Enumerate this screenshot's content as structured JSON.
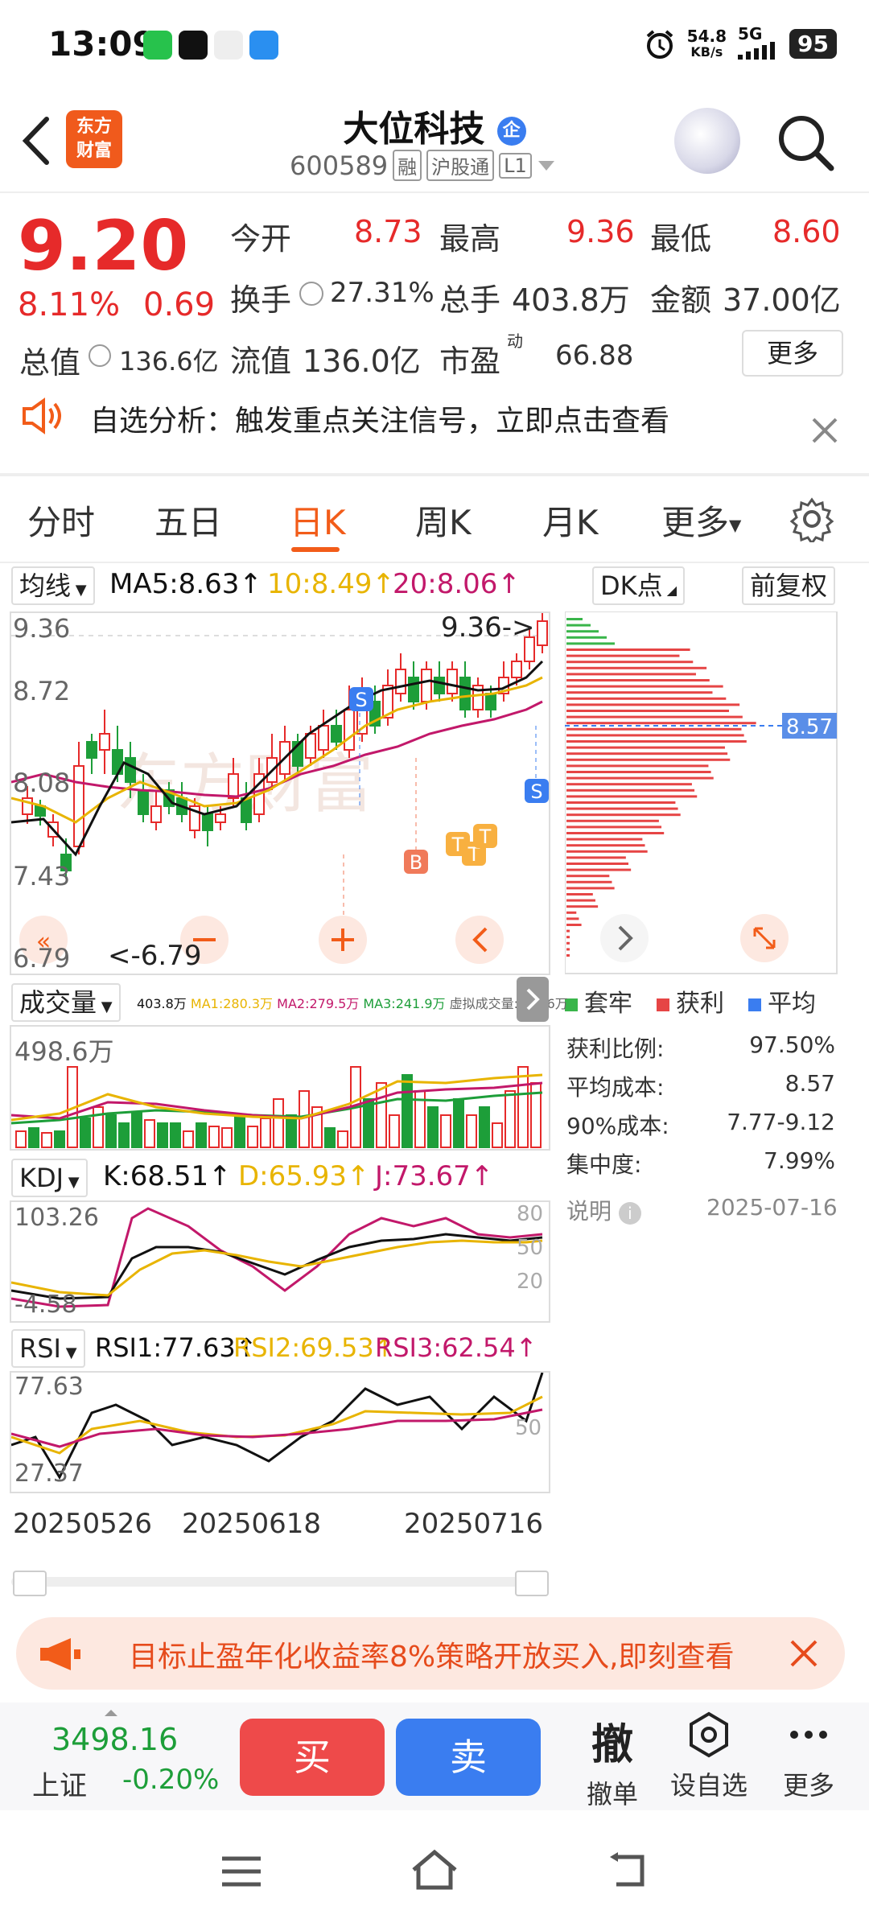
{
  "status_bar": {
    "time": "13:09",
    "net_speed": "54.8",
    "net_unit": "KB/s",
    "signal": "5G",
    "battery": "95"
  },
  "header": {
    "logo_line1": "东方",
    "logo_line2": "财富",
    "stock_name": "大位科技",
    "company_badge": "企",
    "stock_code": "600589",
    "tag_margin": "融",
    "tag_connect": "沪股通",
    "tag_level": "L1"
  },
  "quote": {
    "price": "9.20",
    "change_pct": "8.11%",
    "change_val": "0.69",
    "open_label": "今开",
    "open_val": "8.73",
    "high_label": "最高",
    "high_val": "9.36",
    "low_label": "最低",
    "low_val": "8.60",
    "turnover_label": "换手",
    "turnover_val": "27.31%",
    "volume_label": "总手",
    "volume_val": "403.8万",
    "amount_label": "金额",
    "amount_val": "37.00亿",
    "total_mv_label": "总值",
    "total_mv_val": "136.6亿",
    "float_mv_label": "流值",
    "float_mv_val": "136.0亿",
    "pe_label": "市盈",
    "pe_sup": "动",
    "pe_val": "66.88",
    "more_label": "更多"
  },
  "notice": {
    "text": "自选分析：触发重点关注信号，立即点击查看"
  },
  "tabs": [
    "分时",
    "五日",
    "日K",
    "周K",
    "月K",
    "更多"
  ],
  "kline": {
    "indicator_select": "均线",
    "ma5": "MA5:8.63↑",
    "ma10": "10:8.49↑",
    "ma20": "20:8.06↑",
    "dk_select": "DK点",
    "adjust_select": "前复权",
    "y_labels": [
      "9.36",
      "8.72",
      "8.08",
      "7.43",
      "6.79"
    ],
    "max_label": "9.36->",
    "min_label": "<-6.79",
    "signals": [
      "S",
      "S",
      "B",
      "B",
      "T",
      "T",
      "T"
    ],
    "colors": {
      "up": "#e62a2a",
      "down": "#1d9e39",
      "ma5": "#111111",
      "ma10": "#e8b400",
      "ma20": "#c2186a"
    }
  },
  "chips": {
    "avg_label": "8.57",
    "legend_trapped": "套牢",
    "legend_profit": "获利",
    "legend_avg": "平均",
    "stats": [
      {
        "label": "获利比例:",
        "value": "97.50%"
      },
      {
        "label": "平均成本:",
        "value": "8.57"
      },
      {
        "label": "90%成本:",
        "value": "7.77-9.12"
      },
      {
        "label": "集中度:",
        "value": "7.99%"
      }
    ],
    "note_label": "说明",
    "date": "2025-07-16"
  },
  "volume": {
    "select": "成交量",
    "summary": "403.8万",
    "ma1": "MA1:280.3万",
    "ma2": "MA2:279.5万",
    "ma3": "MA3:241.9万",
    "virtual": "虚拟成交量:498.6万",
    "y_label": "498.6万"
  },
  "kdj": {
    "select": "KDJ",
    "k": "K:68.51↑",
    "d": "D:65.93↑",
    "j": "J:73.67↑",
    "y_top": "103.26",
    "y_bottom": "-4.58",
    "ref80": "80",
    "ref50": "50",
    "ref20": "20"
  },
  "rsi": {
    "select": "RSI",
    "rsi1": "RSI1:77.63↑",
    "rsi2": "RSI2:69.53↑",
    "rsi3": "RSI3:62.54↑",
    "y_top": "77.63",
    "y_bottom": "27.37",
    "ref50": "50"
  },
  "x_axis": [
    "20250526",
    "20250618",
    "20250716"
  ],
  "promo": {
    "text": "目标止盈年化收益率8%策略开放买入,即刻查看"
  },
  "bottom": {
    "index_val": "3498.16",
    "index_name": "上证",
    "index_chg": "-0.20%",
    "buy": "买",
    "sell": "卖",
    "cancel_icon": "撤",
    "cancel_label": "撤单",
    "watch_label": "设自选",
    "more_label": "更多"
  }
}
